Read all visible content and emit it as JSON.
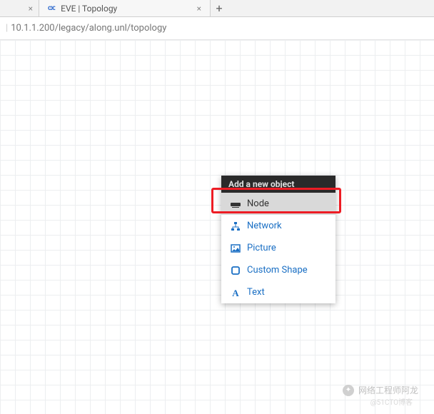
{
  "tabs": {
    "hidden_close": "×",
    "active_title": "EVE | Topology",
    "active_close": "×",
    "new_tab": "+"
  },
  "address": {
    "url": "10.1.1.200/legacy/along.unl/topology"
  },
  "context_menu": {
    "header": "Add a new object",
    "items": [
      {
        "label": "Node"
      },
      {
        "label": "Network"
      },
      {
        "label": "Picture"
      },
      {
        "label": "Custom Shape"
      },
      {
        "label": "Text"
      }
    ]
  },
  "watermark": {
    "text": "网络工程师阿龙",
    "sub": "@51CTO博客"
  }
}
